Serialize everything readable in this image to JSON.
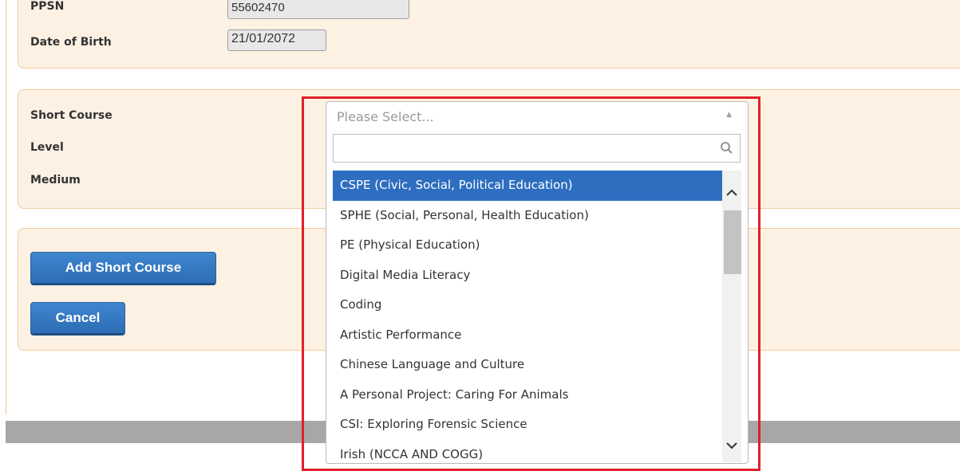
{
  "student": {
    "ppsn_label": "PPSN",
    "ppsn_value": "55602470",
    "dob_label": "Date of Birth",
    "dob_value": "21/01/2072"
  },
  "course_form": {
    "short_course_label": "Short Course",
    "level_label": "Level",
    "medium_label": "Medium"
  },
  "actions": {
    "add_label": "Add Short Course",
    "cancel_label": "Cancel"
  },
  "dropdown": {
    "placeholder": "Please Select...",
    "search_value": "",
    "selected_index": 0,
    "options": [
      "CSPE (Civic, Social, Political Education)",
      "SPHE (Social, Personal, Health Education)",
      "PE (Physical Education)",
      "Digital Media Literacy",
      "Coding",
      "Artistic Performance",
      "Chinese Language and Culture",
      "A Personal Project: Caring For Animals",
      "CSI: Exploring Forensic Science",
      "Irish (NCCA AND COGG)"
    ]
  },
  "colors": {
    "accent": "#2e6ec0",
    "highlight_border": "#e0202a",
    "panel_bg": "#fdf1e3"
  },
  "icons": {
    "search": "search-icon",
    "scroll_up": "chevron-up-icon",
    "scroll_down": "chevron-down-icon",
    "select_arrow": "triangle-up-icon"
  }
}
